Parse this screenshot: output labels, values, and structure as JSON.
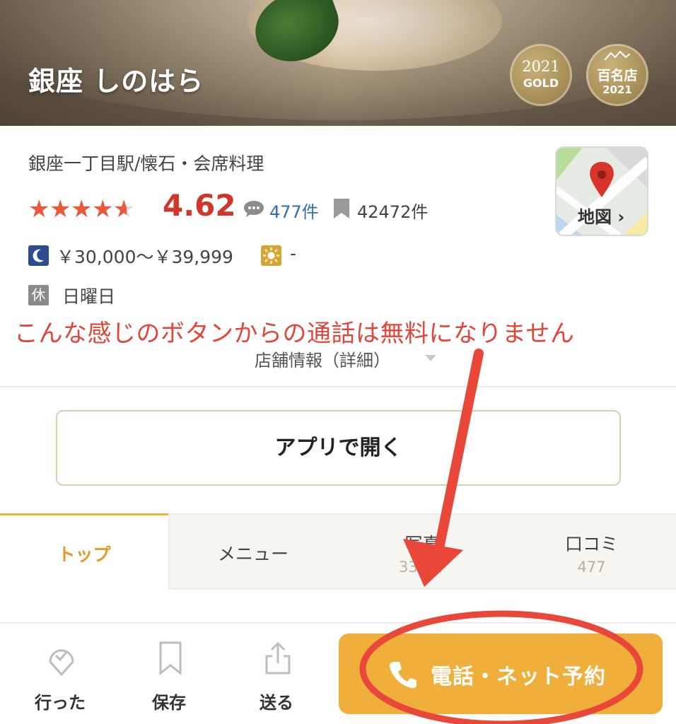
{
  "restaurant": {
    "name": "銀座 しのはら",
    "area_genre": "銀座一丁目駅/懐石・会席料理",
    "rating": "4.62",
    "rating_value": 4.62,
    "review_count": "477件",
    "bookmark_count": "42472件",
    "price_dinner": "￥30,000～￥39,999",
    "price_lunch": "-",
    "holiday_icon": "休",
    "holiday": "日曜日"
  },
  "badges": {
    "gold_year": "2021",
    "gold_label": "GOLD",
    "hyakumeiten_label": "百名店",
    "hyakumeiten_year": "2021"
  },
  "map": {
    "label": "地図",
    "chevron": "›"
  },
  "annotation": "こんな感じのボタンからの通話は無料になりません",
  "detail_link": "店舗情報（詳細）",
  "open_app": "アプリで開く",
  "tabs": [
    {
      "label": "トップ",
      "active": true
    },
    {
      "label": "メニュー"
    },
    {
      "label": "写真",
      "count": "33557"
    },
    {
      "label": "口コミ",
      "count": "477"
    }
  ],
  "bottom_bar": {
    "went": "行った",
    "save": "保存",
    "send": "送る",
    "reserve": "電話・ネット予約"
  },
  "colors": {
    "rating_red": "#d2362a",
    "link_blue": "#2f6fb0",
    "tab_active": "#e8982a",
    "reserve_bg": "#f0ae3b",
    "annotation_red": "#e0463a"
  },
  "icons": [
    "review-bubble-icon",
    "bookmark-icon",
    "map-pin-icon",
    "moon-icon",
    "sun-icon",
    "check-heart-icon",
    "bookmark-outline-icon",
    "share-icon",
    "phone-icon",
    "mountain-icon"
  ]
}
